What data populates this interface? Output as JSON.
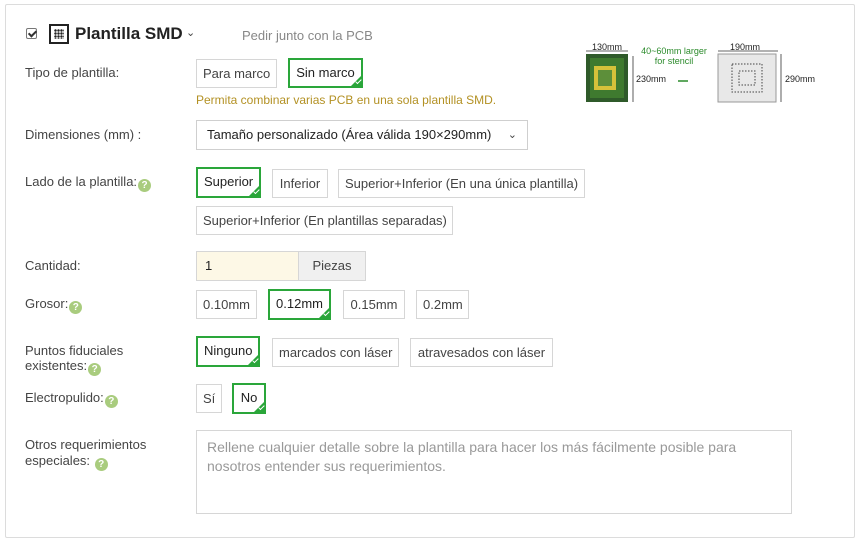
{
  "header": {
    "title": "Plantilla SMD",
    "order_link": "Pedir junto con la PCB",
    "enabled": true
  },
  "diagram": {
    "pcb_width": "130mm",
    "pcb_height": "230mm",
    "note_line1": "40~60mm larger",
    "note_line2": "for stencil",
    "arrow": "➔",
    "stencil_width": "190mm",
    "stencil_height": "290mm"
  },
  "stencil_type": {
    "label": "Tipo de plantilla:",
    "options": [
      "Para marco",
      "Sin marco"
    ],
    "selected": "Sin marco",
    "hint": "Permita combinar varias PCB en una sola plantilla SMD."
  },
  "dimensions": {
    "label": "Dimensiones (mm) :",
    "value": "Tamaño personalizado  (Área válida 190×290mm)"
  },
  "side": {
    "label": "Lado de la plantilla:",
    "options": [
      "Superior",
      "Inferior",
      "Superior+Inferior (En una única plantilla)",
      "Superior+Inferior (En plantillas separadas)"
    ],
    "selected": "Superior"
  },
  "quantity": {
    "label": "Cantidad:",
    "value": "1",
    "unit": "Piezas"
  },
  "thickness": {
    "label": "Grosor:",
    "options": [
      "0.10mm",
      "0.12mm",
      "0.15mm",
      "0.2mm"
    ],
    "selected": "0.12mm"
  },
  "fiducials": {
    "label_line1": "Puntos fiduciales",
    "label_line2": "existentes:",
    "options": [
      "Ninguno",
      "marcados con láser",
      "atravesados con láser"
    ],
    "selected": "Ninguno"
  },
  "electropolish": {
    "label": "Electropulido:",
    "options": [
      "Sí",
      "No"
    ],
    "selected": "No"
  },
  "requirements": {
    "label_line1": "Otros requerimientos",
    "label_line2": "especiales:",
    "placeholder": "Rellene cualquier detalle sobre la plantilla para hacer los más fácilmente posible para nosotros entender sus requerimientos."
  },
  "help_glyph": "?",
  "dropdown_glyph": "⌄",
  "colors": {
    "accent_green": "#2aa63a",
    "hint_gold": "#b39124",
    "help_green": "#a9cc7e",
    "input_bg": "#fdf8e6"
  }
}
